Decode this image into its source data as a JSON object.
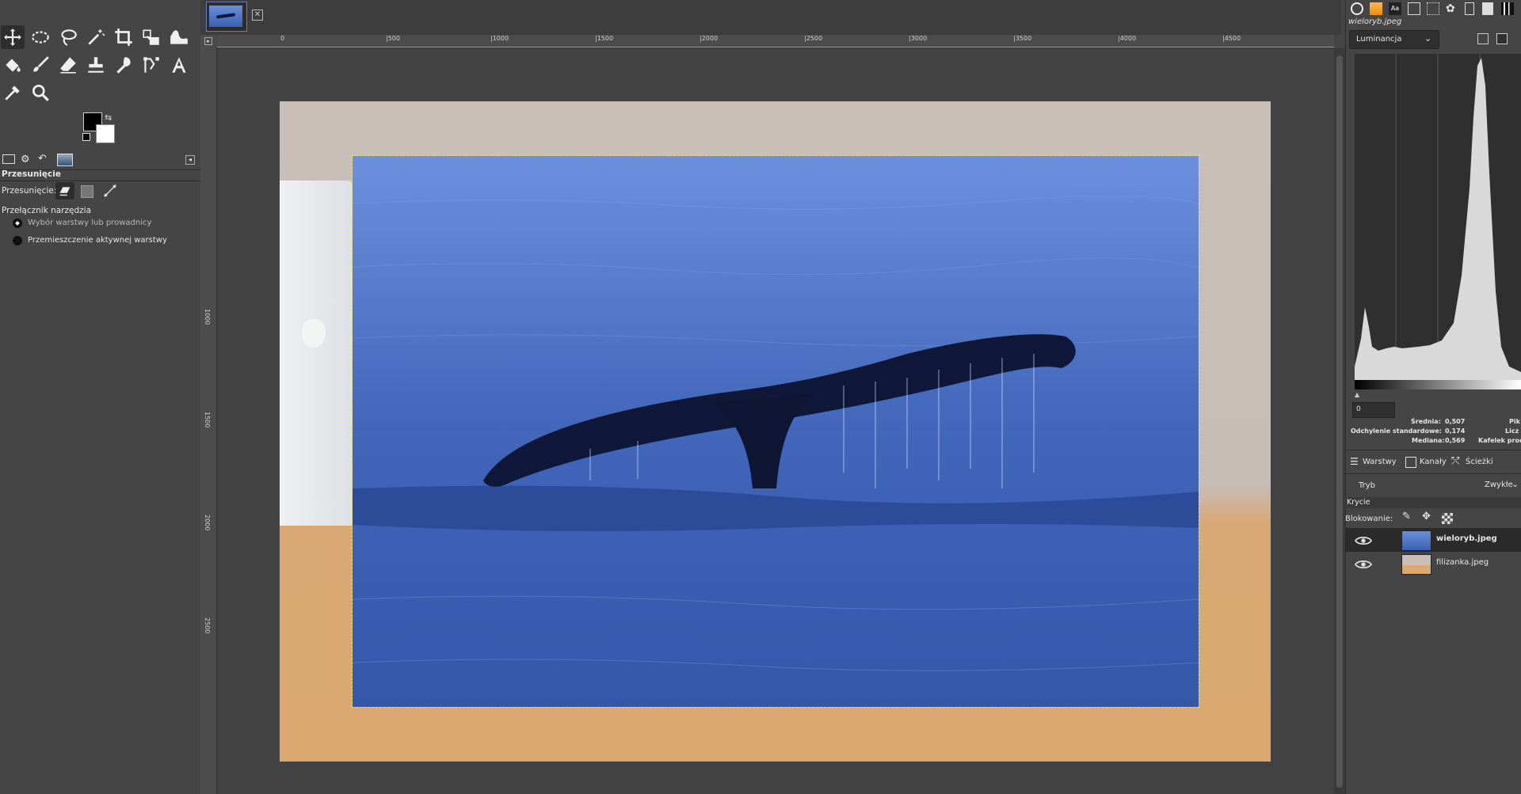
{
  "toolbox": {
    "tool_options_title": "Przesunięcie",
    "move_label": "Przesunięcie:",
    "tool_switch_label": "Przełącznik narzędzia",
    "option_pick": "Wybór warstwy lub prowadnicy",
    "option_active": "Przemieszczenie aktywnej warstwy"
  },
  "canvas": {
    "ruler_ticks_h": [
      "0",
      "|500",
      "|1000",
      "|1500",
      "|2000",
      "|2500",
      "|3000",
      "|3500",
      "|4000",
      "|4500"
    ],
    "ruler_ticks_v": [
      "1000",
      "1500",
      "2000",
      "2500"
    ]
  },
  "right_panel": {
    "image_name": "wieloryb.jpeg",
    "histogram_channel": "Luminancja",
    "range_start": "0",
    "stats": {
      "mean_label": "Średnia:",
      "mean_value": "0,507",
      "std_label": "Odchylenie standardowe:",
      "std_value": "0,174",
      "median_label": "Mediana:",
      "median_value": "0,569",
      "pixels_label": "Pik",
      "count_label": "Licz",
      "percentile_label": "Kafelek proc"
    },
    "tabs": {
      "layers": "Warstwy",
      "channels": "Kanały",
      "paths": "Ścieżki"
    },
    "mode_label": "Tryb",
    "mode_value": "Zwykłe",
    "opacity_label": "Krycie",
    "lock_label": "Blokowanie:",
    "layers": [
      {
        "name": "wieloryb.jpeg"
      },
      {
        "name": "filizanka.jpeg"
      }
    ]
  },
  "colors": {
    "accent_blue": "#5c84d8",
    "selection_dash": "#e8e070"
  }
}
